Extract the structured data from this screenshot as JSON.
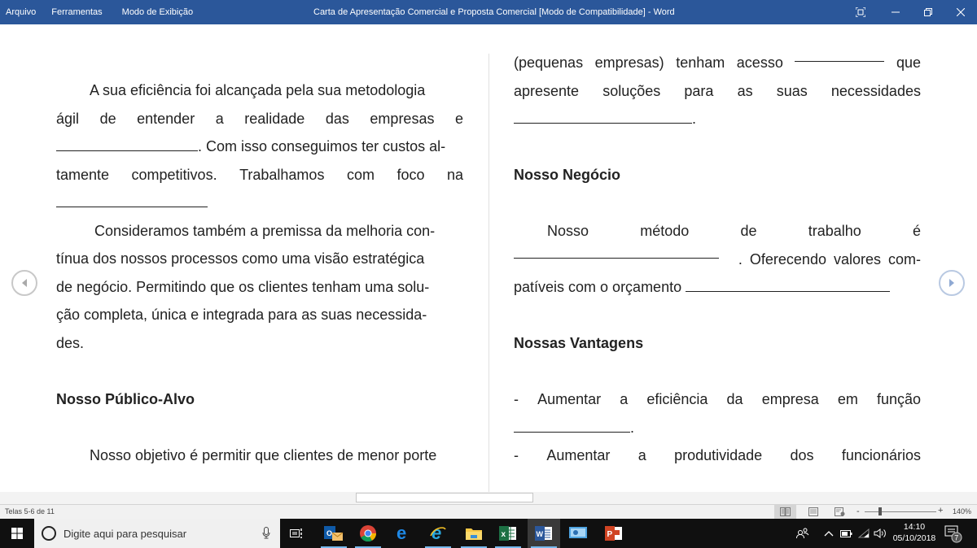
{
  "window": {
    "title": "Carta de Apresentação Comercial e Proposta Comercial [Modo de Compatibilidade]  -  Word",
    "menu": [
      "Arquivo",
      "Ferramentas",
      "Modo de Exibição"
    ],
    "controls": [
      "focus-mode",
      "minimize",
      "restore",
      "close"
    ]
  },
  "document": {
    "left_page": {
      "p1_lines": [
        "A sua eficiência foi alcançada pela sua metodologia",
        [
          "ágil",
          "de",
          "entender",
          "a",
          "realidade",
          "das",
          "empresas",
          "e"
        ],
        ". Com isso conseguimos ter custos al-",
        [
          "tamente",
          "competitivos.",
          "Trabalhamos",
          "com",
          "foco",
          "na"
        ]
      ],
      "p2_lines": [
        "Consideramos também a premissa da melhoria con-",
        "tínua dos nossos processos como uma visão estratégica",
        "de negócio. Permitindo que os clientes tenham uma solu-",
        "ção completa, única e integrada para as suas necessida-",
        "des."
      ],
      "heading": "Nosso Público-Alvo",
      "p3_line": "Nosso objetivo é permitir que clientes de menor porte"
    },
    "right_page": {
      "p1_lines": [
        [
          "(pequenas",
          "empresas)",
          "tenham",
          "acesso",
          "__BLANK__",
          "que"
        ],
        [
          "apresente",
          "soluções",
          "para",
          "as",
          "suas",
          "necessidades"
        ],
        "."
      ],
      "heading1": "Nosso Negócio",
      "p2_lines": [
        [
          "Nosso",
          "método",
          "de",
          "trabalho",
          "é"
        ],
        ". Oferecendo valores com-",
        "patíveis com o orçamento"
      ],
      "heading2": "Nossas Vantagens",
      "list_lines": [
        [
          "-",
          "Aumentar",
          "a",
          "eficiência",
          "da",
          "empresa",
          "em",
          "função"
        ],
        ".",
        [
          "-",
          "Aumentar",
          "a",
          "produtividade",
          "dos",
          "funcionários"
        ]
      ]
    },
    "prev_page_icon": "arrow-left-circle",
    "next_page_icon": "arrow-right-circle"
  },
  "statusbar": {
    "pages": "Telas 5-6 de 11",
    "zoom_minus": "-",
    "zoom_plus": "+",
    "zoom_level": "140%",
    "zoom_percent": 140,
    "views": [
      "read-mode",
      "print-layout",
      "web-layout"
    ],
    "active_view": "read-mode"
  },
  "taskbar": {
    "search_placeholder": "Digite aqui para pesquisar",
    "apps": [
      "outlook",
      "chrome",
      "edge",
      "internet-explorer",
      "file-explorer",
      "excel",
      "word",
      "remote-desktop",
      "powerpoint"
    ],
    "active_app": "word",
    "time": "14:10",
    "date": "05/10/2018",
    "notification_count": "7",
    "colors": {
      "accent": "#2b579a",
      "taskbar": "#101010",
      "running": "#76b9ed"
    }
  }
}
